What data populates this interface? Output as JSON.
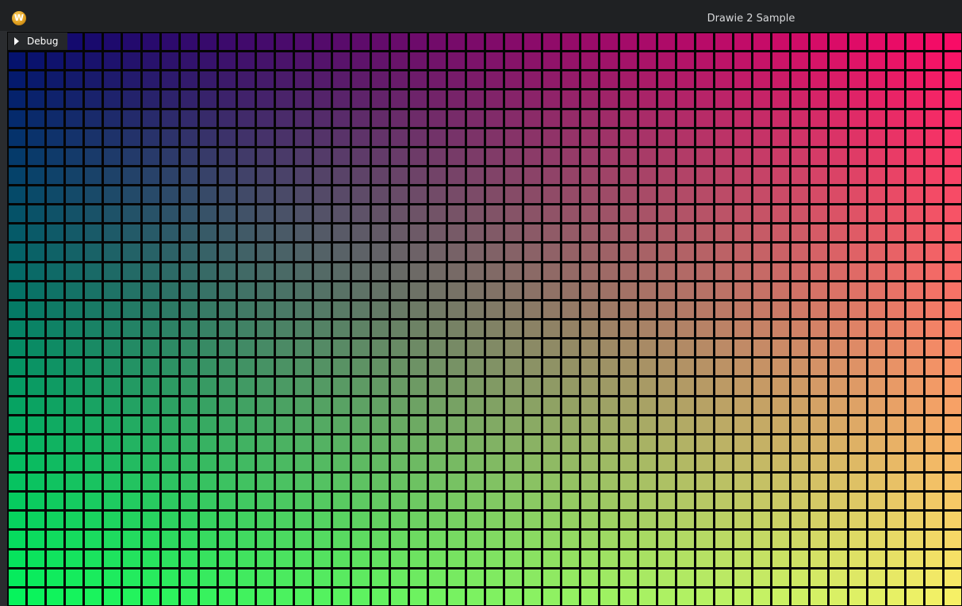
{
  "window": {
    "title": "Drawie 2 Sample",
    "app_icon_glyph": "W",
    "app_icon": "drawie-logo-icon"
  },
  "debug_panel": {
    "label": "Debug",
    "expanded": false,
    "toggle_icon": "triangle-right-icon"
  },
  "grid": {
    "columns": 50,
    "rows": 30,
    "corner_colors": {
      "top_left": "#050a6e",
      "top_right": "#f80c66",
      "bottom_left": "#06f35c",
      "bottom_right": "#f6f066"
    },
    "background": "#050505"
  }
}
